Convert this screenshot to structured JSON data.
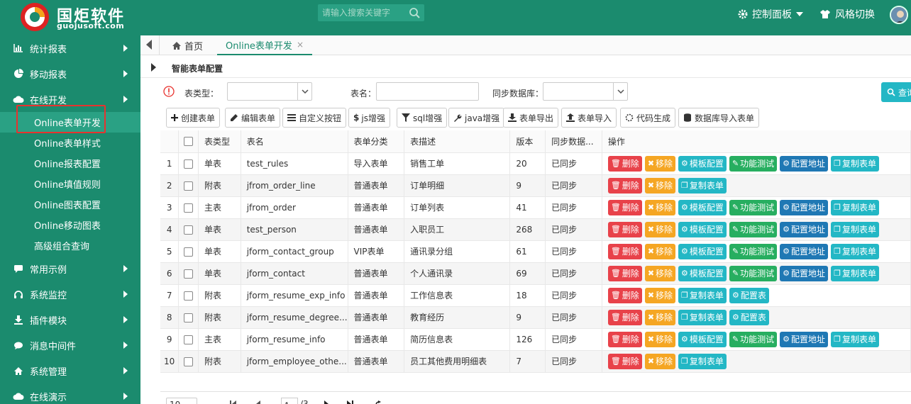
{
  "header": {
    "brand_cn": "国炬软件",
    "brand_en": "guojusoft.com",
    "search_placeholder": "请输入搜索关键字",
    "control_panel": "控制面板",
    "style_switch": "风格切换"
  },
  "sidebar": {
    "items": [
      {
        "label": "统计报表",
        "icon": "bar-chart-icon"
      },
      {
        "label": "移动报表",
        "icon": "pie-chart-icon"
      },
      {
        "label": "在线开发",
        "icon": "cloud-icon"
      },
      {
        "label": "常用示例",
        "icon": "comment-icon"
      },
      {
        "label": "系统监控",
        "icon": "headphones-icon"
      },
      {
        "label": "插件模块",
        "icon": "download-icon"
      },
      {
        "label": "消息中间件",
        "icon": "chat-icon"
      },
      {
        "label": "系统管理",
        "icon": "home-icon"
      },
      {
        "label": "在线演示",
        "icon": "cloud-icon"
      }
    ],
    "subitems": [
      "Online表单开发",
      "Online表单样式",
      "Online报表配置",
      "Online填值规则",
      "Online图表配置",
      "Online移动图表",
      "高级组合查询"
    ]
  },
  "tabs": {
    "home": "首页",
    "active": "Online表单开发",
    "close": "×"
  },
  "panel": {
    "title": "智能表单配置"
  },
  "filters": {
    "type_label": "表类型：",
    "name_label": "表名：",
    "sync_label": "同步数据库：",
    "query_label": "查询"
  },
  "toolbar": {
    "create": "创建表单",
    "edit": "编辑表单",
    "custom_btn": "自定义按钮",
    "js": "js增强",
    "sql": "sql增强",
    "java": "java增强",
    "export": "表单导出",
    "import": "表单导入",
    "codegen": "代码生成",
    "db_import": "数据库导入表单"
  },
  "table": {
    "headers": [
      "",
      "",
      "表类型",
      "表名",
      "表单分类",
      "表描述",
      "版本",
      "同步数据...",
      "操作"
    ],
    "rows": [
      {
        "no": "1",
        "type": "单表",
        "name": "test_rules",
        "cat": "导入表单",
        "desc": "销售工单",
        "ver": "20",
        "sync": "已同步",
        "ops": [
          "删除",
          "移除",
          "模板配置",
          "功能测试",
          "配置地址",
          "复制表单"
        ]
      },
      {
        "no": "2",
        "type": "附表",
        "name": "jfrom_order_line",
        "cat": "普通表单",
        "desc": "订单明细",
        "ver": "9",
        "sync": "已同步",
        "ops": [
          "删除",
          "移除",
          "复制表单"
        ]
      },
      {
        "no": "3",
        "type": "主表",
        "name": "jfrom_order",
        "cat": "普通表单",
        "desc": "订单列表",
        "ver": "41",
        "sync": "已同步",
        "ops": [
          "删除",
          "移除",
          "模板配置",
          "功能测试",
          "配置地址",
          "复制表单"
        ]
      },
      {
        "no": "4",
        "type": "单表",
        "name": "test_person",
        "cat": "普通表单",
        "desc": "入职员工",
        "ver": "268",
        "sync": "已同步",
        "ops": [
          "删除",
          "移除",
          "模板配置",
          "功能测试",
          "配置地址",
          "复制表单"
        ]
      },
      {
        "no": "5",
        "type": "单表",
        "name": "jform_contact_group",
        "cat": "VIP表单",
        "desc": "通讯录分组",
        "ver": "61",
        "sync": "已同步",
        "ops": [
          "删除",
          "移除",
          "模板配置",
          "功能测试",
          "配置地址",
          "复制表单"
        ]
      },
      {
        "no": "6",
        "type": "单表",
        "name": "jform_contact",
        "cat": "普通表单",
        "desc": "个人通讯录",
        "ver": "69",
        "sync": "已同步",
        "ops": [
          "删除",
          "移除",
          "模板配置",
          "功能测试",
          "配置地址",
          "复制表单"
        ]
      },
      {
        "no": "7",
        "type": "附表",
        "name": "jform_resume_exp_info",
        "cat": "普通表单",
        "desc": "工作信息表",
        "ver": "18",
        "sync": "已同步",
        "ops": [
          "删除",
          "移除",
          "复制表单",
          "配置表"
        ]
      },
      {
        "no": "8",
        "type": "附表",
        "name": "jform_resume_degree...",
        "cat": "普通表单",
        "desc": "教育经历",
        "ver": "9",
        "sync": "已同步",
        "ops": [
          "删除",
          "移除",
          "复制表单",
          "配置表"
        ]
      },
      {
        "no": "9",
        "type": "主表",
        "name": "jform_resume_info",
        "cat": "普通表单",
        "desc": "简历信息表",
        "ver": "126",
        "sync": "已同步",
        "ops": [
          "删除",
          "移除",
          "模板配置",
          "功能测试",
          "配置地址",
          "复制表单"
        ]
      },
      {
        "no": "10",
        "type": "附表",
        "name": "jform_employee_othe...",
        "cat": "普通表单",
        "desc": "员工其他费用明细表",
        "ver": "7",
        "sync": "已同步",
        "ops": [
          "删除",
          "移除",
          "复制表单"
        ]
      }
    ]
  },
  "pager": {
    "size": "10",
    "page": "1",
    "total": "/3"
  }
}
